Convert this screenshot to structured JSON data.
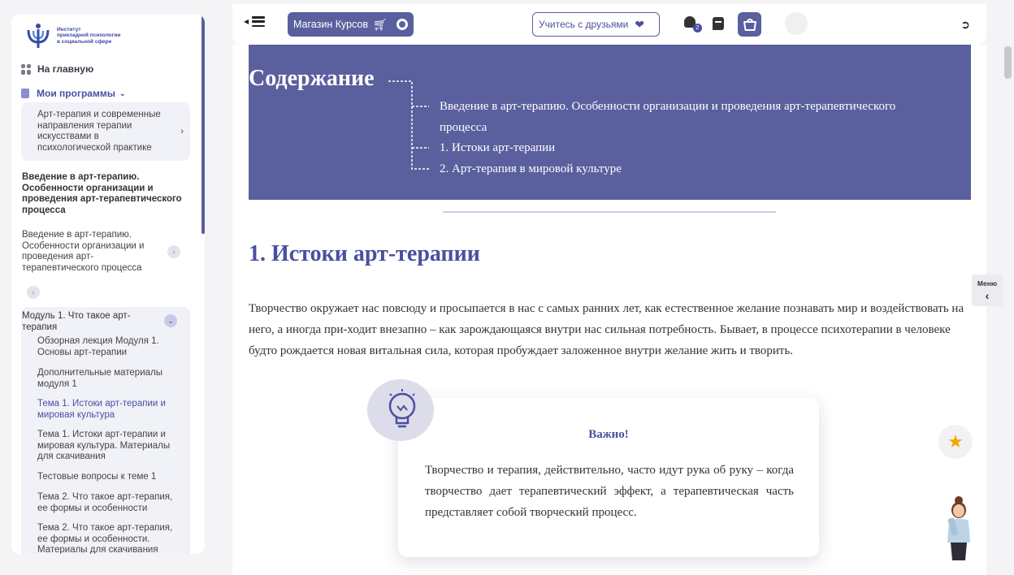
{
  "logo": {
    "line1": "Институт",
    "line2": "прикладной психологии",
    "line3": "в социальной сфере"
  },
  "nav": {
    "home": "На главную",
    "programs": "Мои программы"
  },
  "program_card": "Арт-терапия и современные направления терапии искусствами в психологической практике",
  "active_lesson": "Введение в арт-терапию. Особенности организации и проведения арт-терапевтического процесса",
  "lesson_item": "Введение в арт-терапию. Особенности организации и проведения арт-терапевтического процесса",
  "module": {
    "title": "Модуль 1. Что такое арт-терапия",
    "items": [
      "Обзорная лекция Модуля 1. Основы арт-терапии",
      "Дополнительные материалы модуля 1",
      "Тема 1. Истоки арт-терапии и мировая культура",
      "Тема 1. Истоки арт-терапии и мировая культура. Материалы для скачивания",
      "Тестовые вопросы к теме 1",
      "Тема 2. Что такое арт-терапия, ее формы и особенности",
      "Тема 2. Что такое арт-терапия, ее формы и особенности. Материалы для скачивания"
    ]
  },
  "header": {
    "shop_label": "Магазин Курсов",
    "friends_label": "Учитесь с друзьями",
    "notifications_count": "2"
  },
  "toc": {
    "title": "Содержание",
    "items": [
      "Введение в арт-терапию. Особенности организации и проведения арт-терапевтического процесса",
      "1. Истоки арт-терапии",
      "2. Арт-терапия в мировой культуре"
    ]
  },
  "section": {
    "title": "1. Истоки арт-терапии",
    "paragraph": "Творчество окружает нас повсюду и просыпается в нас с самых ранних лет, как естественное желание познавать мир и воздействовать на него, а иногда при-ходит внезапно – как зарождающаяся внутри нас сильная потребность. Бывает, в процессе психотерапии в человеке будто рождается новая витальная сила, которая пробуждает заложенное внутри желание жить и творить."
  },
  "important": {
    "title": "Важно!",
    "text": "Творчество и терапия, действительно, часто идут рука об руку – когда творчество дает терапевтический эффект, а терапевтическая часть представляет собой творческий процесс."
  },
  "side_menu_label": "Меню",
  "colors": {
    "accent": "#5a5f9e",
    "accent_text": "#4a4fa0",
    "star": "#f2a900"
  }
}
